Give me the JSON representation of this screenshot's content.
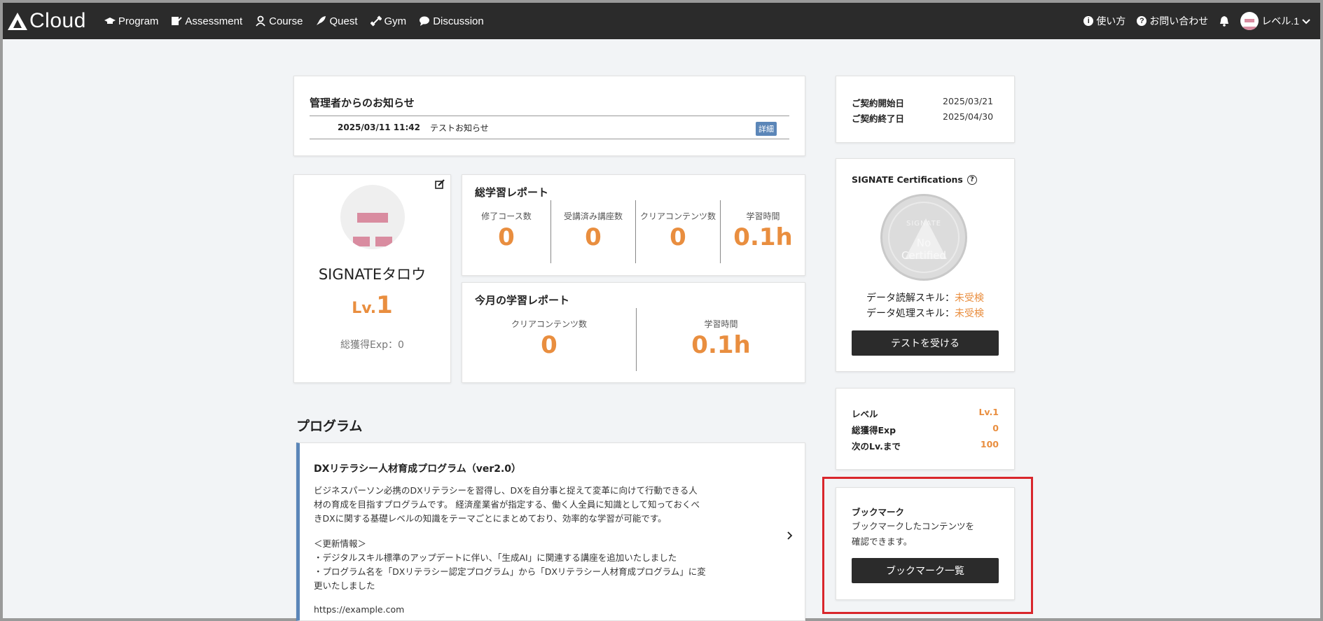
{
  "header": {
    "logo_text": "Cloud",
    "nav": [
      {
        "label": "Program",
        "icon": "graduation-cap-icon"
      },
      {
        "label": "Assessment",
        "icon": "edit-document-icon"
      },
      {
        "label": "Course",
        "icon": "user-tie-icon"
      },
      {
        "label": "Quest",
        "icon": "rocket-icon"
      },
      {
        "label": "Gym",
        "icon": "dumbbell-icon"
      },
      {
        "label": "Discussion",
        "icon": "speech-bubble-icon"
      }
    ],
    "help_label": "使い方",
    "contact_label": "お問い合わせ",
    "user_label": "レベル.1"
  },
  "notice": {
    "title": "管理者からのお知らせ",
    "date": "2025/03/11 11:42",
    "text": "テストお知らせ",
    "detail_label": "詳細"
  },
  "profile": {
    "name": "SIGNATEタロウ",
    "level_prefix": "Lv.",
    "level": "1",
    "exp_text": "総獲得Exp：0"
  },
  "total_report": {
    "title": "総学習レポート",
    "stats": [
      {
        "label": "修了コース数",
        "value": "0"
      },
      {
        "label": "受講済み講座数",
        "value": "0"
      },
      {
        "label": "クリアコンテンツ数",
        "value": "0"
      },
      {
        "label": "学習時間",
        "value": "0.1h"
      }
    ]
  },
  "monthly_report": {
    "title": "今月の学習レポート",
    "stats": [
      {
        "label": "クリアコンテンツ数",
        "value": "0"
      },
      {
        "label": "学習時間",
        "value": "0.1h"
      }
    ]
  },
  "program_section": {
    "title": "プログラム",
    "program": {
      "title": "DXリテラシー人材育成プログラム（ver2.0）",
      "description": "ビジネスパーソン必携のDXリテラシーを習得し、DXを自分事と捉えて変革に向けて行動できる人材の育成を目指すプログラムです。 経済産業省が指定する、働く人全員に知識として知っておくべきDXに関する基礎レベルの知識をテーマごとにまとめており、効率的な学習が可能です。",
      "update_heading": "＜更新情報＞",
      "update_1": "・デジタルスキル標準のアップデートに伴い、「生成AI」に関連する講座を追加いたしました",
      "update_2": "・プログラム名を「DXリテラシー認定プログラム」から「DXリテラシー人材育成プログラム」に変更いたしました",
      "url": "https://example.com"
    }
  },
  "contract": {
    "start_label": "ご契約開始日",
    "start_value": "2025/03/21",
    "end_label": "ご契約終了日",
    "end_value": "2025/04/30"
  },
  "certifications": {
    "title": "SIGNATE Certifications",
    "badge_top": "SIGNATE",
    "badge_line1": "No",
    "badge_line2": "Certified",
    "skill1_label": "データ読解スキル：",
    "skill1_status": "未受検",
    "skill2_label": "データ処理スキル：",
    "skill2_status": "未受検",
    "button_label": "テストを受ける"
  },
  "level_card": {
    "rows": [
      {
        "label": "レベル",
        "value": "Lv.1"
      },
      {
        "label": "総獲得Exp",
        "value": "0"
      },
      {
        "label": "次のLv.まで",
        "value": "100"
      }
    ]
  },
  "bookmark": {
    "title": "ブックマーク",
    "description": "ブックマークしたコンテンツを確認できます。",
    "button_label": "ブックマーク一覧"
  },
  "colors": {
    "accent": "#e98e3f",
    "topbar": "#2b2b2b",
    "link_blue": "#5b86b8",
    "highlight_red": "#d9262c"
  }
}
